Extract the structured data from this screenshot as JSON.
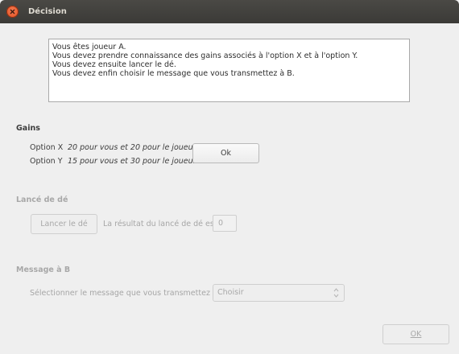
{
  "window": {
    "title": "Décision"
  },
  "instructions": [
    "Vous êtes joueur A.",
    "Vous devez prendre connaissance des gains associés à l'option X et à l'option Y.",
    "Vous devez ensuite lancer le dé.",
    "Vous devez enfin choisir le message que vous transmettez à B."
  ],
  "gains": {
    "title": "Gains",
    "option_x_label": "Option X",
    "option_x_value": "20 pour vous et 20 pour le joueur B",
    "option_y_label": "Option Y",
    "option_y_value": "15 pour vous et 30 pour le joueur B",
    "ok_label": "Ok"
  },
  "dice": {
    "title": "Lancé de dé",
    "roll_button": "Lancer le dé",
    "result_label": "La résultat du lancé de dé est",
    "result_value": "0"
  },
  "message": {
    "title": "Message à B",
    "select_label": "Sélectionner le message que vous transmettez à B",
    "select_value": "Choisir"
  },
  "footer": {
    "ok_label": "OK"
  }
}
